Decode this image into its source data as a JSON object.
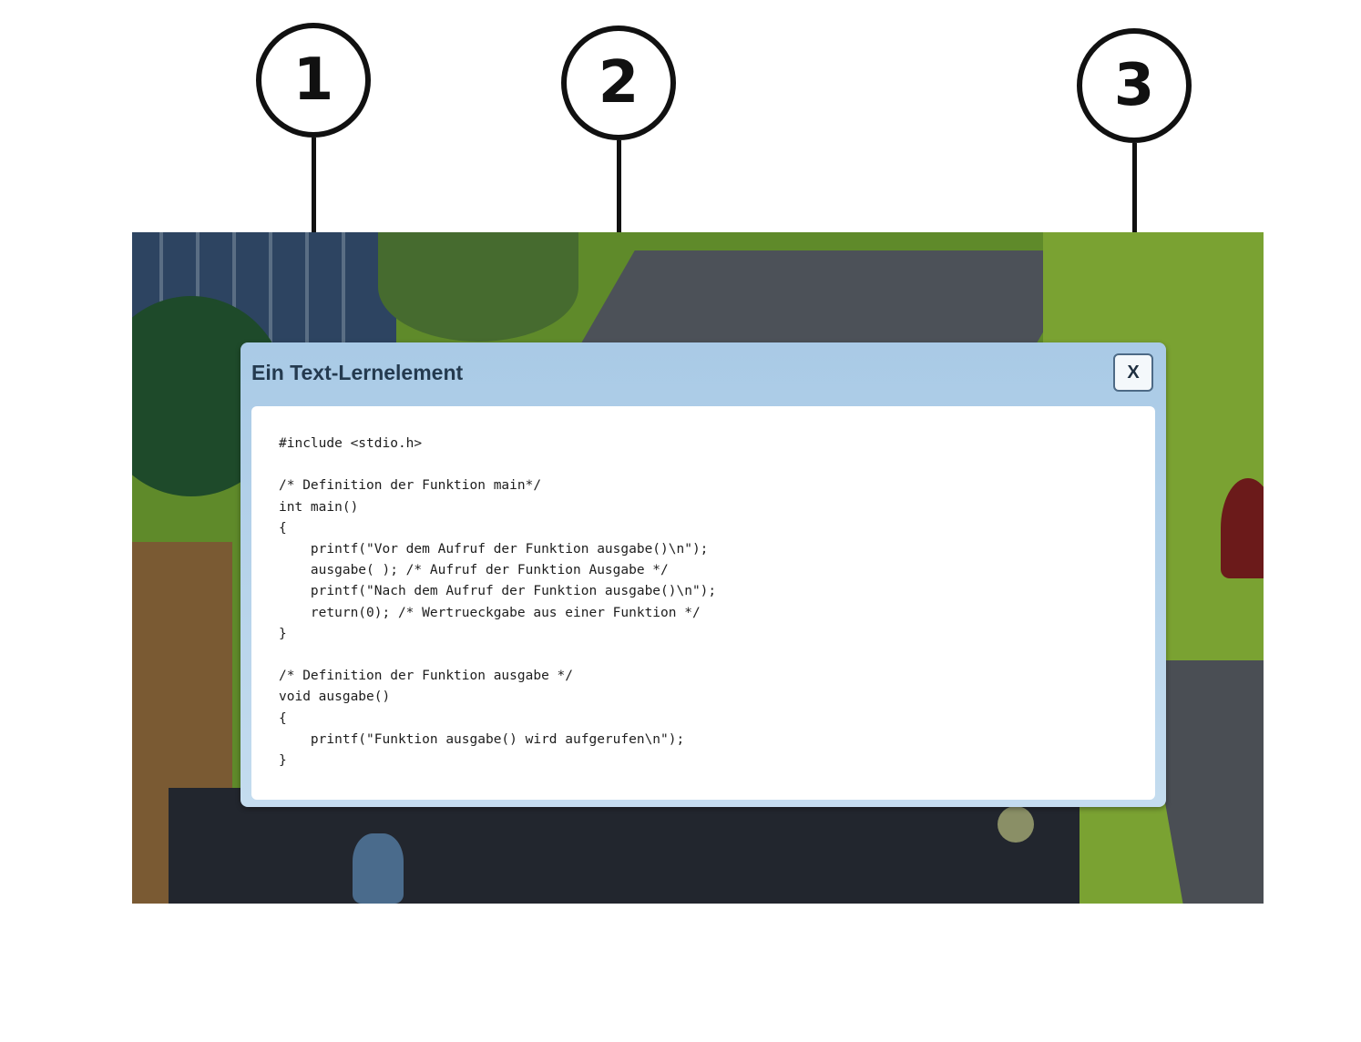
{
  "callouts": [
    "1",
    "2",
    "3"
  ],
  "dialog": {
    "title": "Ein Text-Lernelement",
    "close_label": "X",
    "code": "#include <stdio.h>\n\n/* Definition der Funktion main*/\nint main()\n{\n    printf(\"Vor dem Aufruf der Funktion ausgabe()\\n\");\n    ausgabe( ); /* Aufruf der Funktion Ausgabe */\n    printf(\"Nach dem Aufruf der Funktion ausgabe()\\n\");\n    return(0); /* Wertrueckgabe aus einer Funktion */\n}\n\n/* Definition der Funktion ausgabe */\nvoid ausgabe()\n{\n    printf(\"Funktion ausgabe() wird aufgerufen\\n\");\n}"
  },
  "colors": {
    "dialog_header": "#a9cae6",
    "title_text": "#243a4f",
    "content_bg": "#ffffff",
    "grass": "#6f9a2c",
    "path": "#4a4e54",
    "ground_dark": "#22262e"
  }
}
